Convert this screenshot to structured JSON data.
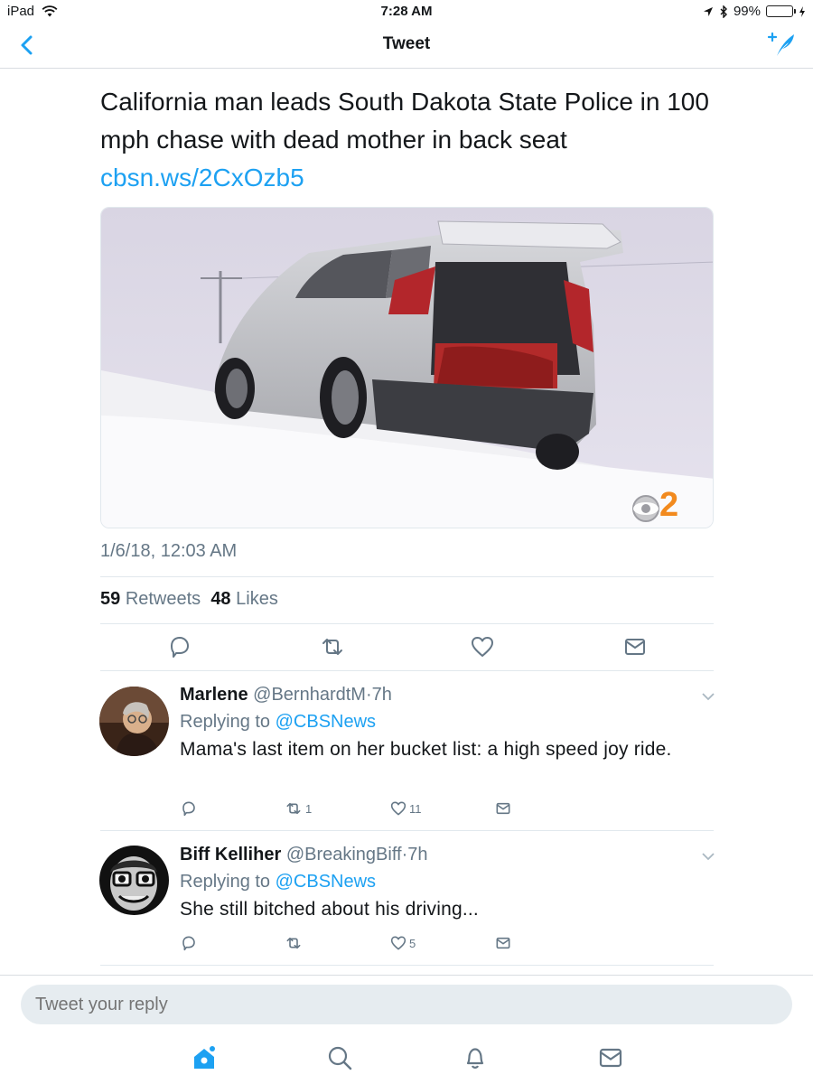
{
  "status_bar": {
    "device": "iPad",
    "time": "7:28 AM",
    "battery": "99%",
    "battery_level": 0.99
  },
  "nav": {
    "title": "Tweet",
    "back_icon": "chevron-left-icon",
    "compose_icon": "compose-tweet-icon"
  },
  "tweet": {
    "text": "California man leads South Dakota State Police in 100 mph chase with dead mother in back seat ",
    "link_text": "cbsn.ws/2CxOzb5",
    "media_watermark": "2",
    "timestamp": "1/6/18, 12:03 AM",
    "retweets_count": "59",
    "retweets_label": "Retweets",
    "likes_count": "48",
    "likes_label": "Likes",
    "actions": [
      "reply-icon",
      "retweet-icon",
      "like-icon",
      "share-icon"
    ]
  },
  "replies": [
    {
      "name": "Marlene",
      "handle": "@BernhardtM",
      "separator": "·",
      "time": "7h",
      "replying_to_label": "Replying to",
      "replying_to_handle": "@CBSNews",
      "text": "Mama's last item on her bucket list: a high speed joy ride.",
      "retweets": "1",
      "likes": "11"
    },
    {
      "name": "Biff Kelliher",
      "handle": "@BreakingBiff",
      "separator": "·",
      "time": "7h",
      "replying_to_label": "Replying to",
      "replying_to_handle": "@CBSNews",
      "text": "She still bitched about his driving...",
      "retweets": "",
      "likes": "5"
    }
  ],
  "reply_bar": {
    "placeholder": "Tweet your reply"
  },
  "tab_bar": {
    "items": [
      "home-icon",
      "search-icon",
      "notifications-icon",
      "messages-icon"
    ]
  },
  "colors": {
    "accent": "#1da1f2",
    "secondary_text": "#657786",
    "divider": "#e1e8ed"
  }
}
